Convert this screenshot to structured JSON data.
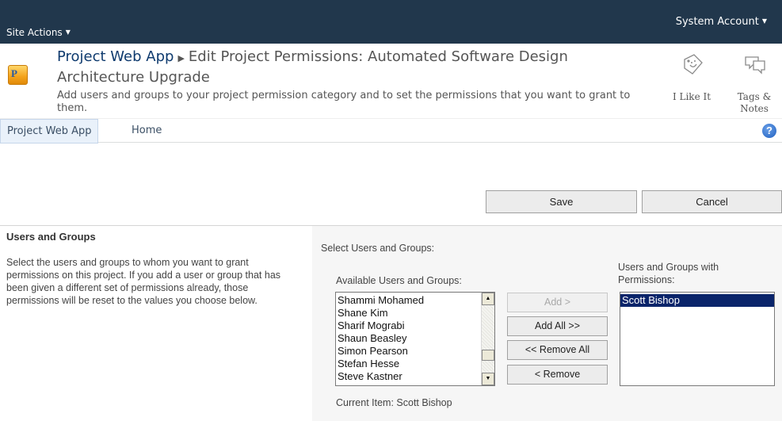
{
  "topbar": {
    "site_actions": "Site Actions",
    "account": "System Account"
  },
  "header": {
    "breadcrumb_root": "Project Web App",
    "breadcrumb_page": "Edit Project Permissions: Automated Software Design Architecture Upgrade",
    "description": "Add users and groups to your project permission category and to set the permissions that you want to grant to them.",
    "like_label": "I Like It",
    "tags_label": "Tags & Notes"
  },
  "nav": {
    "items": [
      {
        "label": "Project Web App"
      },
      {
        "label": "Home"
      }
    ]
  },
  "actions": {
    "save": "Save",
    "cancel": "Cancel"
  },
  "users_section": {
    "title": "Users and Groups",
    "description": "Select the users and groups to whom you want to grant permissions on this project. If you add a user or group that has been given a different set of permissions already, those permissions will be reset to the values you choose below.",
    "select_label": "Select Users and Groups:",
    "available_label": "Available Users and Groups:",
    "available": [
      "Shammi Mohamed",
      "Shane Kim",
      "Sharif Mograbi",
      "Shaun Beasley",
      "Simon Pearson",
      "Stefan Hesse",
      "Steve Kastner"
    ],
    "with_permissions_label": "Users and Groups with Permissions:",
    "with_permissions": [
      "Scott Bishop"
    ],
    "add": "Add >",
    "add_all": "Add All >>",
    "remove_all": "<< Remove All",
    "remove": "< Remove",
    "current_item": "Current Item: Scott Bishop"
  },
  "colors": {
    "topbar": "#21374c",
    "selection": "#0a246a",
    "right_panel": "#f6f6f6"
  }
}
